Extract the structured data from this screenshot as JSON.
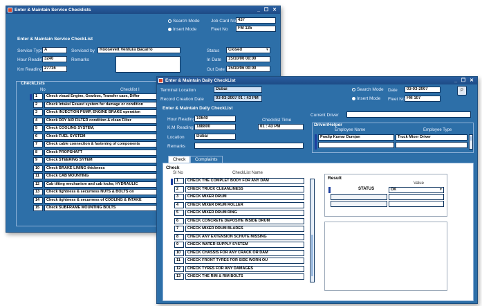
{
  "service_window": {
    "title": "Enter & Maintain Service Checklists",
    "controls": "_ ❐ ✕",
    "search_mode": "Search Mode",
    "insert_mode": "Insert Mode",
    "job_card_label": "Job Card No",
    "job_card_value": "437",
    "fleet_label": "Fleet No",
    "fleet_value": "FM 135",
    "section_title": "Enter & Maintain Service CheckList",
    "service_type_label": "Service Type",
    "service_type_value": "A",
    "serviced_by_label": "Serviced by",
    "serviced_by_value": "Roosevelt Ventura  Bacarro",
    "status_label": "Status",
    "status_value": "Closed",
    "hour_reading_label": "Hour Reading",
    "hour_reading_value": "3240",
    "remarks_label": "Remarks",
    "in_date_label": "In Date",
    "in_date_value": "15/10/06 00:00",
    "km_reading_label": "Km Reading",
    "km_reading_value": "27716",
    "out_date_label": "Out Date",
    "out_date_value": "15/10/06 00:00",
    "checklists_title": "CheckLists",
    "col_no": "No",
    "col_checklist": "Checklist I",
    "rows": [
      {
        "no": "1",
        "text": "Check visual Engine, Gearbox, Transfer case, Differ"
      },
      {
        "no": "2",
        "text": "Check Intake/ Exaust system for damage or condition"
      },
      {
        "no": "3",
        "text": "Check INJECTION PUMP, ENGINE BRAKE operation"
      },
      {
        "no": "4",
        "text": "Check DRY AIR FILTER condition & clean Filter"
      },
      {
        "no": "5",
        "text": "Check COOLING SYSTEM,"
      },
      {
        "no": "6",
        "text": "Check FUEL SYSTEM"
      },
      {
        "no": "7",
        "text": "Check cable connection & fastening of components"
      },
      {
        "no": "8",
        "text": "Check PROPSHAFT"
      },
      {
        "no": "9",
        "text": "Check STEERING SYTEM"
      },
      {
        "no": "10",
        "text": "Check  BRAKE LINING thickness"
      },
      {
        "no": "11",
        "text": "Check CAB MOUNTING"
      },
      {
        "no": "12",
        "text": "Cab tilting mechanism and cab locks; HYDRAULIC"
      },
      {
        "no": "13",
        "text": "Check tightness & securness  NUTS & BOLTS on"
      },
      {
        "no": "14",
        "text": "Check tightness & securness of COOLING & INTAKE"
      },
      {
        "no": "15",
        "text": "Check SUBFRAME MOUNTING BOLTS"
      }
    ]
  },
  "daily_window": {
    "title": "Enter & Maintain Daily CheckList",
    "controls": "_ ❐ ✕",
    "terminal_label": "Terminal Location",
    "terminal_value": "Dubai",
    "record_date_label": "Record Creation Date",
    "record_date_value": "03-03-2007  01 : 43 PM",
    "search_mode": "Search Mode",
    "insert_mode": "Insert Mode",
    "date_label": "Date",
    "date_value": "03-03-2007",
    "fleet_label": "Fleet No",
    "fleet_value": "FM 107",
    "p_button": "P",
    "section_title": "Enter & Maintain Daily CheckList",
    "current_driver_label": "Current Driver",
    "hour_reading_label": "Hour Reading",
    "hour_reading_value": "10640",
    "checklist_time_label": "Checklist Time",
    "km_reading_label": "K.M Reading",
    "km_reading_value": "188800",
    "checklist_time_value": "01 : 43 PM",
    "location_label": "Location",
    "location_value": "Dubai",
    "remarks_label": "Remarks",
    "driver_helper_title": "Driver/Helper",
    "employee_name_header": "Employee Name",
    "employee_type_header": "Employee Type",
    "employee_name": "Pradip Kumar  Dumjan",
    "employee_type": "Truck Mixer Driver",
    "tab_check": "Check",
    "tab_complaints": "Complaints",
    "check_group_title": "Check",
    "col_slno": "Sl No",
    "col_checklist_name": "CheckList Name",
    "check_rows": [
      {
        "no": "1",
        "text": "CHECK THE COMPLET BODY FOR ANY DAM"
      },
      {
        "no": "2",
        "text": "CHECK TRUCK CLEANLINESS"
      },
      {
        "no": "3",
        "text": "CHECK MIXER DRUM"
      },
      {
        "no": "4",
        "text": "CHECK MIXER DRUM ROLLER"
      },
      {
        "no": "5",
        "text": "CHECK MIXER DRUM RING"
      },
      {
        "no": "6",
        "text": "CHECK CONCRETE DEPOSITE INSIDE DRUM"
      },
      {
        "no": "7",
        "text": "CHECK MIXER DRUM BLADES"
      },
      {
        "no": "8",
        "text": "CHECK ANY EXTENSION SCHUTE MISSING"
      },
      {
        "no": "9",
        "text": "CHECK WATER SUPPLY SYSTEM"
      },
      {
        "no": "10",
        "text": "CHECK CHASSIS FOR ANY CRACK OR DAM"
      },
      {
        "no": "11",
        "text": "CHECK FRONT TYRES FOR SIDE WORN OU"
      },
      {
        "no": "12",
        "text": "CHECK TYRES FOR ANY DAMAGES"
      },
      {
        "no": "13",
        "text": "CHECK THE RIM & RIM BOLTS"
      }
    ],
    "result_title": "Result",
    "value_header": "Value",
    "status_label": "STATUS",
    "status_value": "OK"
  },
  "colors": {
    "window_bg": "#2d6fa8",
    "titlebar": "#1d4a85",
    "field_bg": "#ffffff",
    "selection": "#1c3fa0"
  }
}
